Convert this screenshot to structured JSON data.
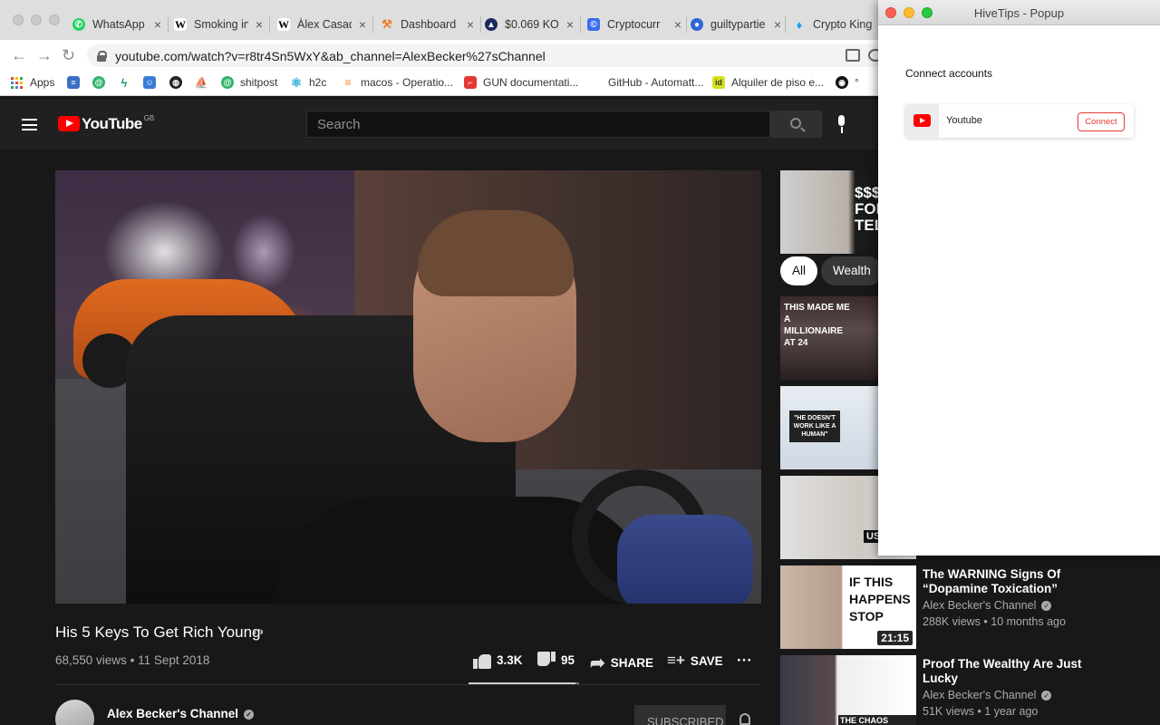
{
  "browser": {
    "tabs": [
      {
        "label": "WhatsApp",
        "icon": "whatsapp-icon",
        "color": "#25d366"
      },
      {
        "label": "Smoking in",
        "icon": "wikipedia-icon",
        "color": "#ffffff"
      },
      {
        "label": "Àlex Casad",
        "icon": "wikipedia-icon",
        "color": "#ffffff"
      },
      {
        "label": "Dashboard",
        "icon": "pickaxe-icon",
        "color": "#f07a2c"
      },
      {
        "label": "$0.069 KO",
        "icon": "coin-icon",
        "color": "#1b2a5e"
      },
      {
        "label": "Cryptocurr",
        "icon": "coingecko-icon",
        "color": "#3a6df0"
      },
      {
        "label": "guiltypartie",
        "icon": "cloud-icon",
        "color": "#2f66d6"
      },
      {
        "label": "Crypto King",
        "icon": "twitter-icon",
        "color": "#1da1f2"
      }
    ],
    "tab_close": "×",
    "url": "youtube.com/watch?v=r8tr4Sn5WxY&ab_channel=AlexBecker%27sChannel",
    "bookmarks": [
      {
        "label": "Apps",
        "icon": "apps-grid-icon"
      },
      {
        "label": "",
        "icon": "docs-icon",
        "color": "#3b6fc6"
      },
      {
        "label": "",
        "icon": "swirl-icon",
        "color": "#33b36b"
      },
      {
        "label": "",
        "icon": "lightning-icon",
        "color": "#1aa36a"
      },
      {
        "label": "",
        "icon": "robot-icon",
        "color": "#3a7bd5"
      },
      {
        "label": "",
        "icon": "globe-icon",
        "color": "#222222"
      },
      {
        "label": "",
        "icon": "ship-icon",
        "color": "#555555"
      },
      {
        "label": "shitpost",
        "icon": "swirl-icon",
        "color": "#33b36b"
      },
      {
        "label": "h2c",
        "icon": "react-icon",
        "color": "#26a5d6"
      },
      {
        "label": "macos - Operatio...",
        "icon": "stackoverflow-icon",
        "color": "#f48024"
      },
      {
        "label": "GUN documentati...",
        "icon": "gun-icon",
        "color": "#e53935"
      },
      {
        "label": "GitHub - Automatt...",
        "icon": "",
        "color": ""
      },
      {
        "label": "Alquiler de piso e...",
        "icon": "idealista-icon",
        "color": "#d4e21b"
      },
      {
        "label": "°",
        "icon": "github-icon",
        "color": "#111111"
      }
    ]
  },
  "youtube": {
    "logo_text": "YouTube",
    "region": "GB",
    "search_placeholder": "Search",
    "video": {
      "title": "His 5 Keys To Get Rich Young",
      "views": "68,550 views",
      "date": "11 Sept 2018",
      "likes": "3.3K",
      "dislikes": "95",
      "like_ratio": 0.97,
      "share_label": "SHARE",
      "save_label": "SAVE",
      "more_label": "···"
    },
    "channel": {
      "name": "Alex Becker's Channel",
      "subscribe_label": "SUBSCRIBED"
    },
    "chips": [
      "All",
      "Wealth"
    ],
    "recommendations": [
      {
        "thumb_text": "$$$ GU FORG TELL",
        "title": "",
        "channel": "",
        "meta": "",
        "duration": ""
      },
      {
        "thumb_text": "THIS MADE ME A MILLIONAIRE AT 24",
        "title": "",
        "channel": "",
        "meta": "",
        "duration": ""
      },
      {
        "thumb_text": "\"HE DOESN'T WORK LIKE A HUMAN\"",
        "title": "",
        "channel": "",
        "meta": "",
        "duration": ""
      },
      {
        "thumb_text": "US",
        "title": "",
        "channel": "",
        "meta": "",
        "duration": ""
      },
      {
        "thumb_text": "IF THIS HAPPENS STOP",
        "title": "The WARNING Signs Of “Dopamine Toxication”",
        "channel": "Alex Becker's Channel",
        "meta": "288K views • 10 months ago",
        "duration": "21:15"
      },
      {
        "thumb_text": "THE CHAOS DANGER",
        "title": "Proof The Wealthy Are Just Lucky",
        "channel": "Alex Becker's Channel",
        "meta": "51K views • 1 year ago",
        "duration": ""
      }
    ]
  },
  "popup": {
    "window_title": "HiveTips - Popup",
    "heading": "Connect accounts",
    "accounts": [
      {
        "name": "Youtube",
        "button_label": "Connect"
      }
    ]
  }
}
